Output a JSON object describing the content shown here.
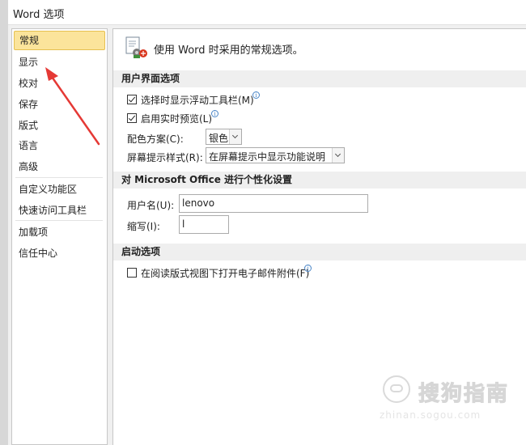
{
  "window": {
    "title": "Word 选项"
  },
  "sidebar": {
    "items": [
      {
        "label": "常规",
        "selected": true
      },
      {
        "label": "显示"
      },
      {
        "label": "校对"
      },
      {
        "label": "保存"
      },
      {
        "label": "版式"
      },
      {
        "label": "语言"
      },
      {
        "label": "高级"
      },
      {
        "label": "自定义功能区"
      },
      {
        "label": "快速访问工具栏"
      },
      {
        "label": "加载项"
      },
      {
        "label": "信任中心"
      }
    ]
  },
  "content": {
    "header": {
      "text": "使用 Word 时采用的常规选项。",
      "icon": "general-options-icon"
    },
    "ui_section": {
      "title": "用户界面选项",
      "mini_toolbar": {
        "label": "选择时显示浮动工具栏(M)",
        "checked": true
      },
      "live_preview": {
        "label": "启用实时预览(L)",
        "checked": true
      },
      "color_scheme": {
        "label": "配色方案(C):",
        "value": "银色"
      },
      "screentip_style": {
        "label": "屏幕提示样式(R):",
        "value": "在屏幕提示中显示功能说明"
      }
    },
    "personalize_section": {
      "title": "对 Microsoft Office 进行个性化设置",
      "username": {
        "label": "用户名(U):",
        "value": "lenovo"
      },
      "initials": {
        "label": "缩写(I):",
        "value": "l"
      }
    },
    "startup_section": {
      "title": "启动选项",
      "open_email_attachments": {
        "label": "在阅读版式视图下打开电子邮件附件(F)",
        "checked": false
      }
    }
  },
  "annotation": {
    "color": "#e53935"
  },
  "watermark": {
    "text": "搜狗指南",
    "sub": "zhinan.sogou.com"
  },
  "colors": {
    "selected_bg": "#fbe49b",
    "section_bg": "#efefef",
    "info_icon": "#4a86c8"
  }
}
